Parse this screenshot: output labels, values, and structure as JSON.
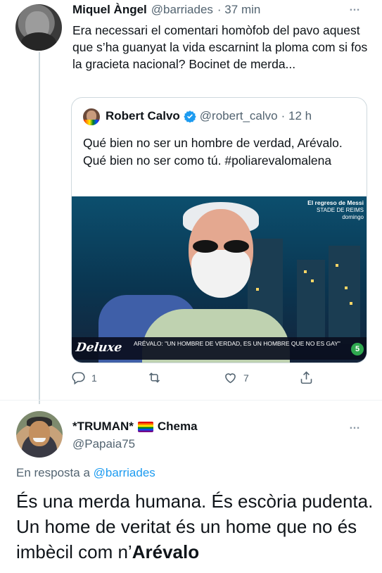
{
  "tweet": {
    "author_name": "Miquel Àngel",
    "author_handle": "@barriades",
    "time": "· 37 min",
    "text": "Era necessari el comentari homòfob del pavo aquest que s’ha guanyat la vida escarnint la ploma com si fos la gracieta nacional? Bocinet de merda...",
    "more_icon": "…",
    "quoted": {
      "author_name": "Robert Calvo",
      "author_handle": "@robert_calvo",
      "time": "· 12 h",
      "text": "Qué bien no ser un hombre de verdad, Arévalo. Qué bien no ser como tú. #poliarevalomalena",
      "media": {
        "show_logo": "Deluxe",
        "caption": "ARÉVALO: \"UN HOMBRE DE VERDAD, ES UN HOMBRE QUE NO ES GAY\"",
        "promo_title": "El regreso de Messi",
        "promo_sub1": "STADE DE REIMS",
        "promo_sub2": "domingo",
        "channel": "5"
      }
    },
    "actions": {
      "reply_count": "1",
      "retweet_count": "",
      "like_count": "7",
      "share_count": ""
    }
  },
  "reply": {
    "author_name": "*TRUMAN*",
    "author_name_suffix": "Chema",
    "author_handle": "@Papaia75",
    "more_icon": "…",
    "reply_to_prefix": "En resposta a",
    "reply_to_handle": "@barriades",
    "text_plain": "És una merda humana. És escòria pudenta. Un home de veritat és un home que no és imbècil com n’",
    "text_bold": "Arévalo"
  },
  "colors": {
    "link": "#1d9bf0",
    "muted": "#536471",
    "verified": "#1d9bf0"
  }
}
